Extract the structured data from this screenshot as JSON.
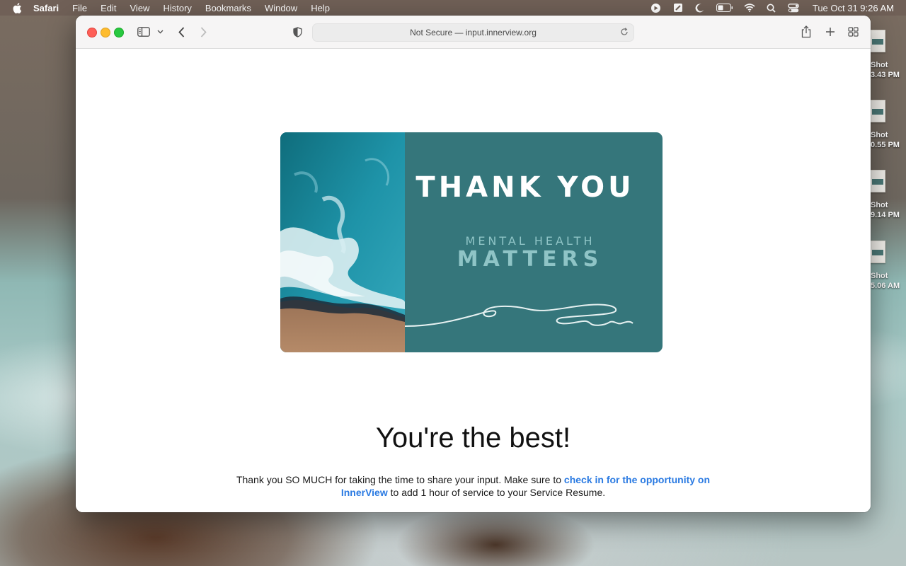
{
  "menubar": {
    "app_name": "Safari",
    "items": [
      "File",
      "Edit",
      "View",
      "History",
      "Bookmarks",
      "Window",
      "Help"
    ],
    "clock": "Tue Oct 31  9:26 AM"
  },
  "desktop_files": [
    {
      "line1": "Shot",
      "line2": "3.43 PM"
    },
    {
      "line1": "Shot",
      "line2": "0.55 PM"
    },
    {
      "line1": "Shot",
      "line2": "9.14 PM"
    },
    {
      "line1": "Shot",
      "line2": "5.06 AM"
    }
  ],
  "browser": {
    "address_text": "Not Secure — input.innerview.org"
  },
  "page": {
    "banner": {
      "title": "THANK YOU",
      "subtitle_line1": "MENTAL  HEALTH",
      "subtitle_line2": "MATTERS"
    },
    "headline": "You're the best!",
    "body_before": "Thank you SO MUCH for taking the time to share your input. Make sure to ",
    "body_link": "check in for the opportunity on InnerView",
    "body_after": " to add 1 hour of service to your Service Resume."
  },
  "colors": {
    "banner_teal": "#35767b",
    "link_blue": "#2a7ae2"
  }
}
